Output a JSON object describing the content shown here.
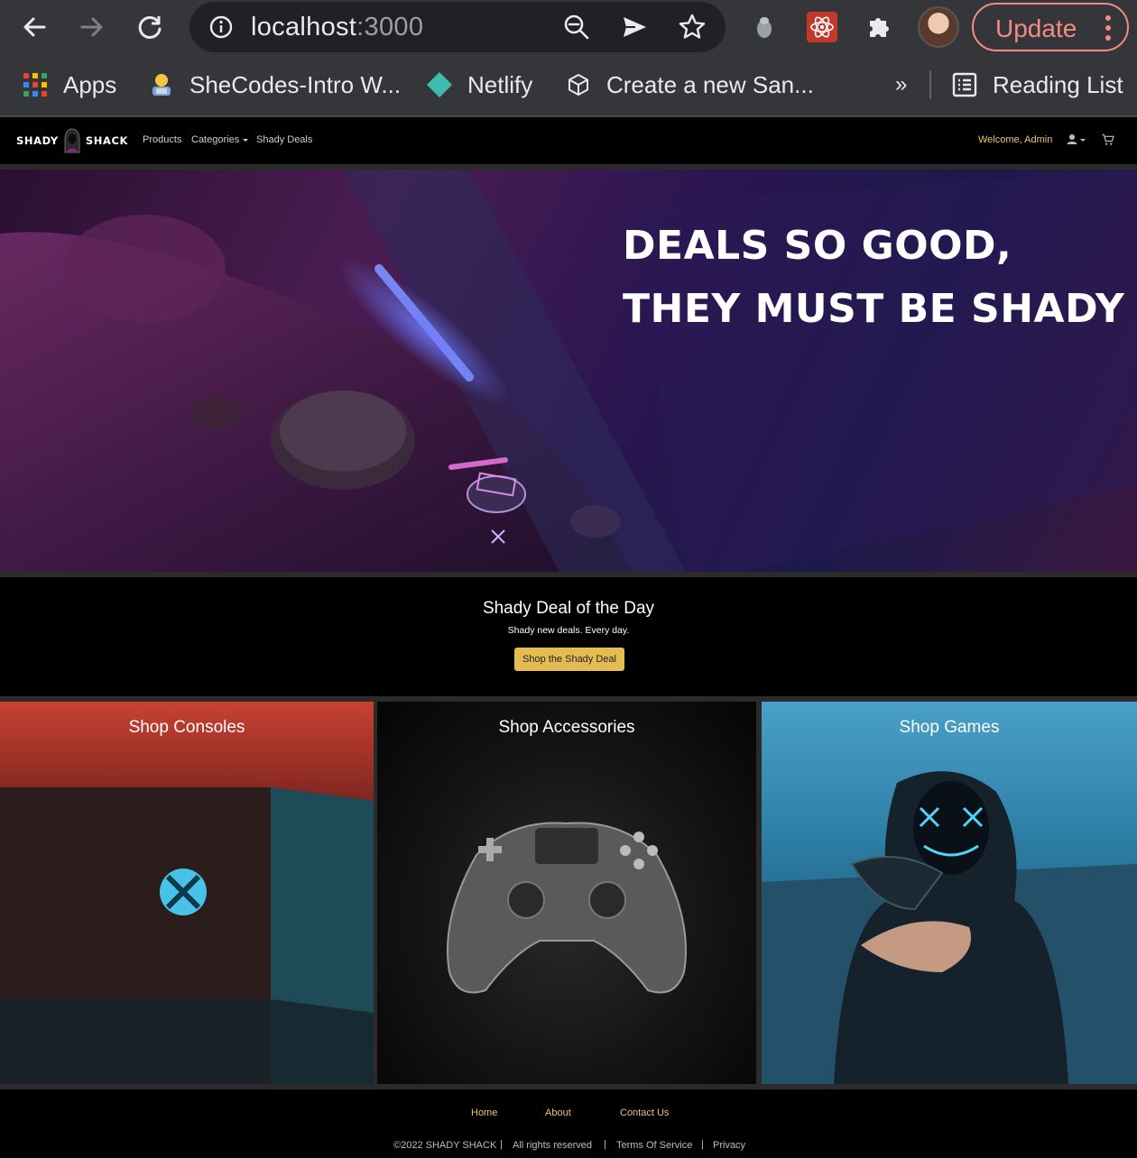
{
  "browser": {
    "url_host": "localhost",
    "url_port": ":3000",
    "update_label": "Update",
    "icons": [
      "back-arrow-icon",
      "forward-arrow-icon",
      "reload-icon",
      "info-icon",
      "zoom-out-icon",
      "send-icon",
      "star-icon",
      "bug-extension-icon",
      "react-devtools-icon",
      "puzzle-extensions-icon"
    ]
  },
  "bookmarks": {
    "items": [
      {
        "label": "Apps",
        "icon": "apps-grid-icon"
      },
      {
        "label": "SheCodes-Intro W...",
        "icon": "shecodes-icon"
      },
      {
        "label": "Netlify",
        "icon": "netlify-icon"
      },
      {
        "label": "Create a new San...",
        "icon": "codesandbox-icon"
      }
    ],
    "overflow": "»",
    "reading_list": "Reading List"
  },
  "site": {
    "logo_left": "SHADY",
    "logo_right": "SHACK",
    "nav": {
      "products": "Products",
      "categories": "Categories",
      "shady_deals": "Shady Deals"
    },
    "welcome": "Welcome, Admin"
  },
  "hero": {
    "line1": "DEALS SO GOOD,",
    "line2": "THEY MUST BE SHADY"
  },
  "deal": {
    "title": "Shady Deal of the Day",
    "subtitle": "Shady new deals. Every day.",
    "button": "Shop the Shady Deal"
  },
  "tiles": {
    "consoles": "Shop Consoles",
    "accessories": "Shop Accessories",
    "games": "Shop Games"
  },
  "footer": {
    "links": {
      "home": "Home",
      "about": "About",
      "contact": "Contact Us"
    },
    "copyright": "©2022 SHADY SHACK",
    "rights": "All rights reserved",
    "terms": "Terms Of Service",
    "privacy": "Privacy",
    "separator": "|"
  },
  "colors": {
    "accent_gold": "#e3bd52",
    "welcome_text": "#f2c46b",
    "update_red": "#f28b82"
  }
}
